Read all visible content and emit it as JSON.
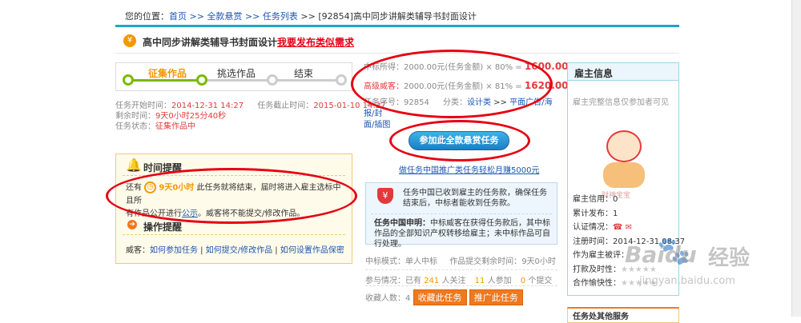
{
  "breadcrumb": {
    "prefix": "您的位置：",
    "items": [
      "首页",
      "全款悬赏",
      "任务列表"
    ],
    "sep": " >> ",
    "current": "[92854]高中同步讲解类辅导书封面设计"
  },
  "task": {
    "title": "高中同步讲解类辅导书封面设计",
    "post_similar": "我要发布类似需求",
    "steps": [
      "征集作品",
      "挑选作品",
      "结束"
    ],
    "start_label": "任务开始时间：",
    "start_value": "2014-12-31 14:27",
    "end_label": "任务截止时间：",
    "end_value": "2015-01-10 14:27",
    "remain_label": "剩余时间：",
    "remain_value": "9天0小时25分40秒",
    "status_label": "任务状态：",
    "status_value": "征集作品中"
  },
  "reminder": {
    "title": "时间提醒",
    "line_prefix": "还有",
    "days": "9天0小时",
    "line_rest": "此任务就将结束，届时将进入雇主选标中且所",
    "line2_a": "有作品公开进行",
    "line2_link": "公示",
    "line2_b": "。威客将不能提交/修改作品。"
  },
  "ops": {
    "title": "操作提醒",
    "prefix": "威客：",
    "links": [
      "如何参加任务",
      "如何提交/修改作品",
      "如何设置作品保密"
    ],
    "sep": " | "
  },
  "prices": {
    "bid_label": "中标所得：",
    "bid_formula": "2000.00元(任务金额) × 80% =",
    "bid_amount": "1600.00",
    "bid_unit": "元",
    "senior_label": "高级威客：",
    "senior_formula": "2000.00元(任务金额) × 81% =",
    "senior_amount": "1620.00",
    "senior_unit": "元",
    "seq_label": "任务序号：",
    "seq_value": "92854",
    "cat_label": "分类：",
    "cat_a": "设计类",
    "cat_sep": " >> ",
    "cat_b": "平面广告/海报/封",
    "cat_c": "面/插图"
  },
  "join": {
    "button": "参加此全款悬赏任务",
    "guarantee": "做任务中国推广类任务轻松月赚5000元"
  },
  "notice": {
    "p1": "任务中国已收到雇主的任务款，确保任务结束后，中标者能收到任务款。",
    "p2_bold": "任务中国申明：",
    "p2": "中标威客在获得任务款后，其中标作品的全部知识产权转移给雇主；未中标作品可自行处理。"
  },
  "stats": {
    "mode_label": "中标模式：",
    "mode_value": "单人中标",
    "submit_label": "作品提交剩余时间：",
    "submit_value": "9天0小时",
    "join_label": "参与情况：已有",
    "watchers": "241",
    "watch_unit": "人关注",
    "participants": "11",
    "part_unit": "人参加",
    "submits": "0",
    "sub_unit": "个提交",
    "fav_label": "收藏人数：",
    "fav_value": "4",
    "fav_btn": "收藏此任务",
    "promo_btn": "推广此任务"
  },
  "employer": {
    "title": "雇主信息",
    "hidden": "雇主完整信息仅参加者可见",
    "mascot": "财神宝宝",
    "credit_label": "雇主信用：",
    "credit_value": "0",
    "total_label": "累计发布：",
    "total_value": "1",
    "auth_label": "认证情况：",
    "reg_label": "注册时间：",
    "reg_value": "2014-12-31 08:37",
    "as_label": "作为雇主被评：",
    "pay_label": "打款及时性：",
    "coop_label": "合作愉快性：",
    "stars": "★★★★★"
  },
  "bottom_cut": "任务处其他服务",
  "watermark": {
    "brand": "Baidu",
    "brand_cn": "经验",
    "url": "jingyan.baidu.com"
  }
}
